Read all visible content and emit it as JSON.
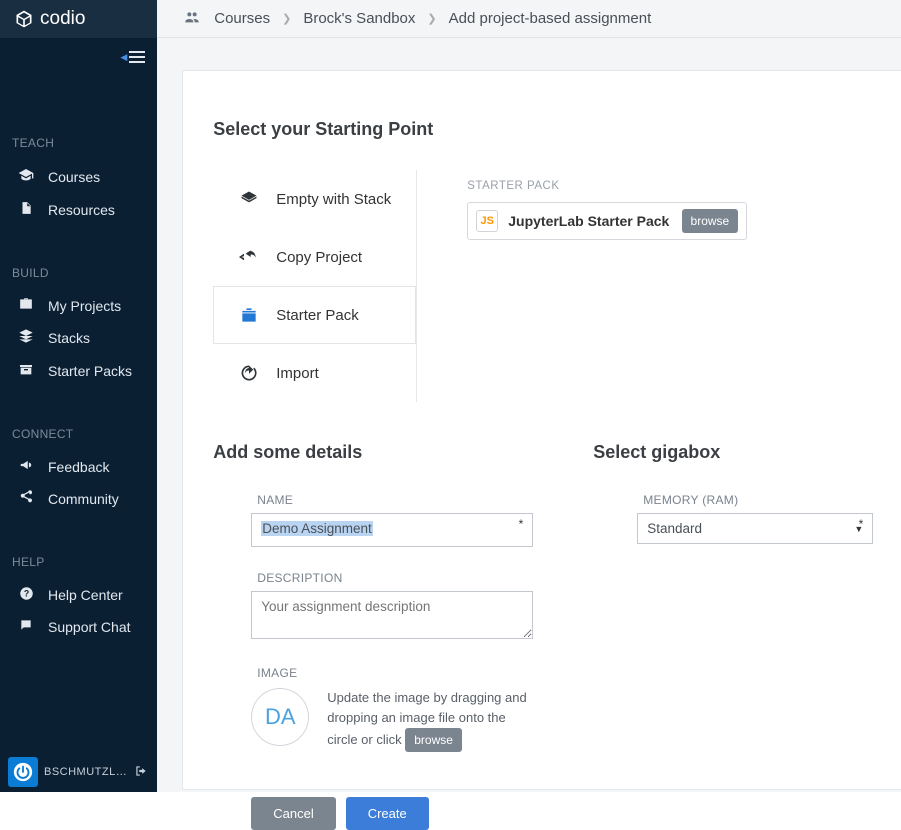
{
  "brand": "codio",
  "sidebar": {
    "sections": [
      {
        "heading": "TEACH",
        "items": [
          {
            "icon": "graduation",
            "label": "Courses"
          },
          {
            "icon": "file",
            "label": "Resources"
          }
        ]
      },
      {
        "heading": "BUILD",
        "items": [
          {
            "icon": "briefcase",
            "label": "My Projects"
          },
          {
            "icon": "stack",
            "label": "Stacks"
          },
          {
            "icon": "box",
            "label": "Starter Packs"
          }
        ]
      },
      {
        "heading": "CONNECT",
        "items": [
          {
            "icon": "megaphone",
            "label": "Feedback"
          },
          {
            "icon": "share",
            "label": "Community"
          }
        ]
      },
      {
        "heading": "HELP",
        "items": [
          {
            "icon": "help",
            "label": "Help Center"
          },
          {
            "icon": "chat",
            "label": "Support Chat"
          }
        ]
      }
    ],
    "user": "BSCHMUTZL…"
  },
  "breadcrumbs": {
    "items": [
      "Courses",
      "Brock's Sandbox",
      "Add project-based assignment"
    ]
  },
  "starting_point": {
    "heading": "Select your Starting Point",
    "options": [
      {
        "label": "Empty with Stack"
      },
      {
        "label": "Copy Project"
      },
      {
        "label": "Starter Pack",
        "selected": true
      },
      {
        "label": "Import"
      }
    ],
    "pack_label": "STARTER PACK",
    "pack_badge": "JS",
    "pack_name": "JupyterLab Starter Pack",
    "browse": "browse"
  },
  "details": {
    "heading": "Add some details",
    "name_label": "NAME",
    "name_value": "Demo Assignment",
    "desc_label": "DESCRIPTION",
    "desc_placeholder": "Your assignment description",
    "image_label": "IMAGE",
    "image_initials": "DA",
    "image_text_1": "Update the image by dragging and dropping an image file onto the circle or click ",
    "image_browse": "browse"
  },
  "gigabox": {
    "heading": "Select gigabox",
    "memory_label": "MEMORY (RAM)",
    "memory_value": "Standard"
  },
  "buttons": {
    "cancel": "Cancel",
    "create": "Create"
  }
}
